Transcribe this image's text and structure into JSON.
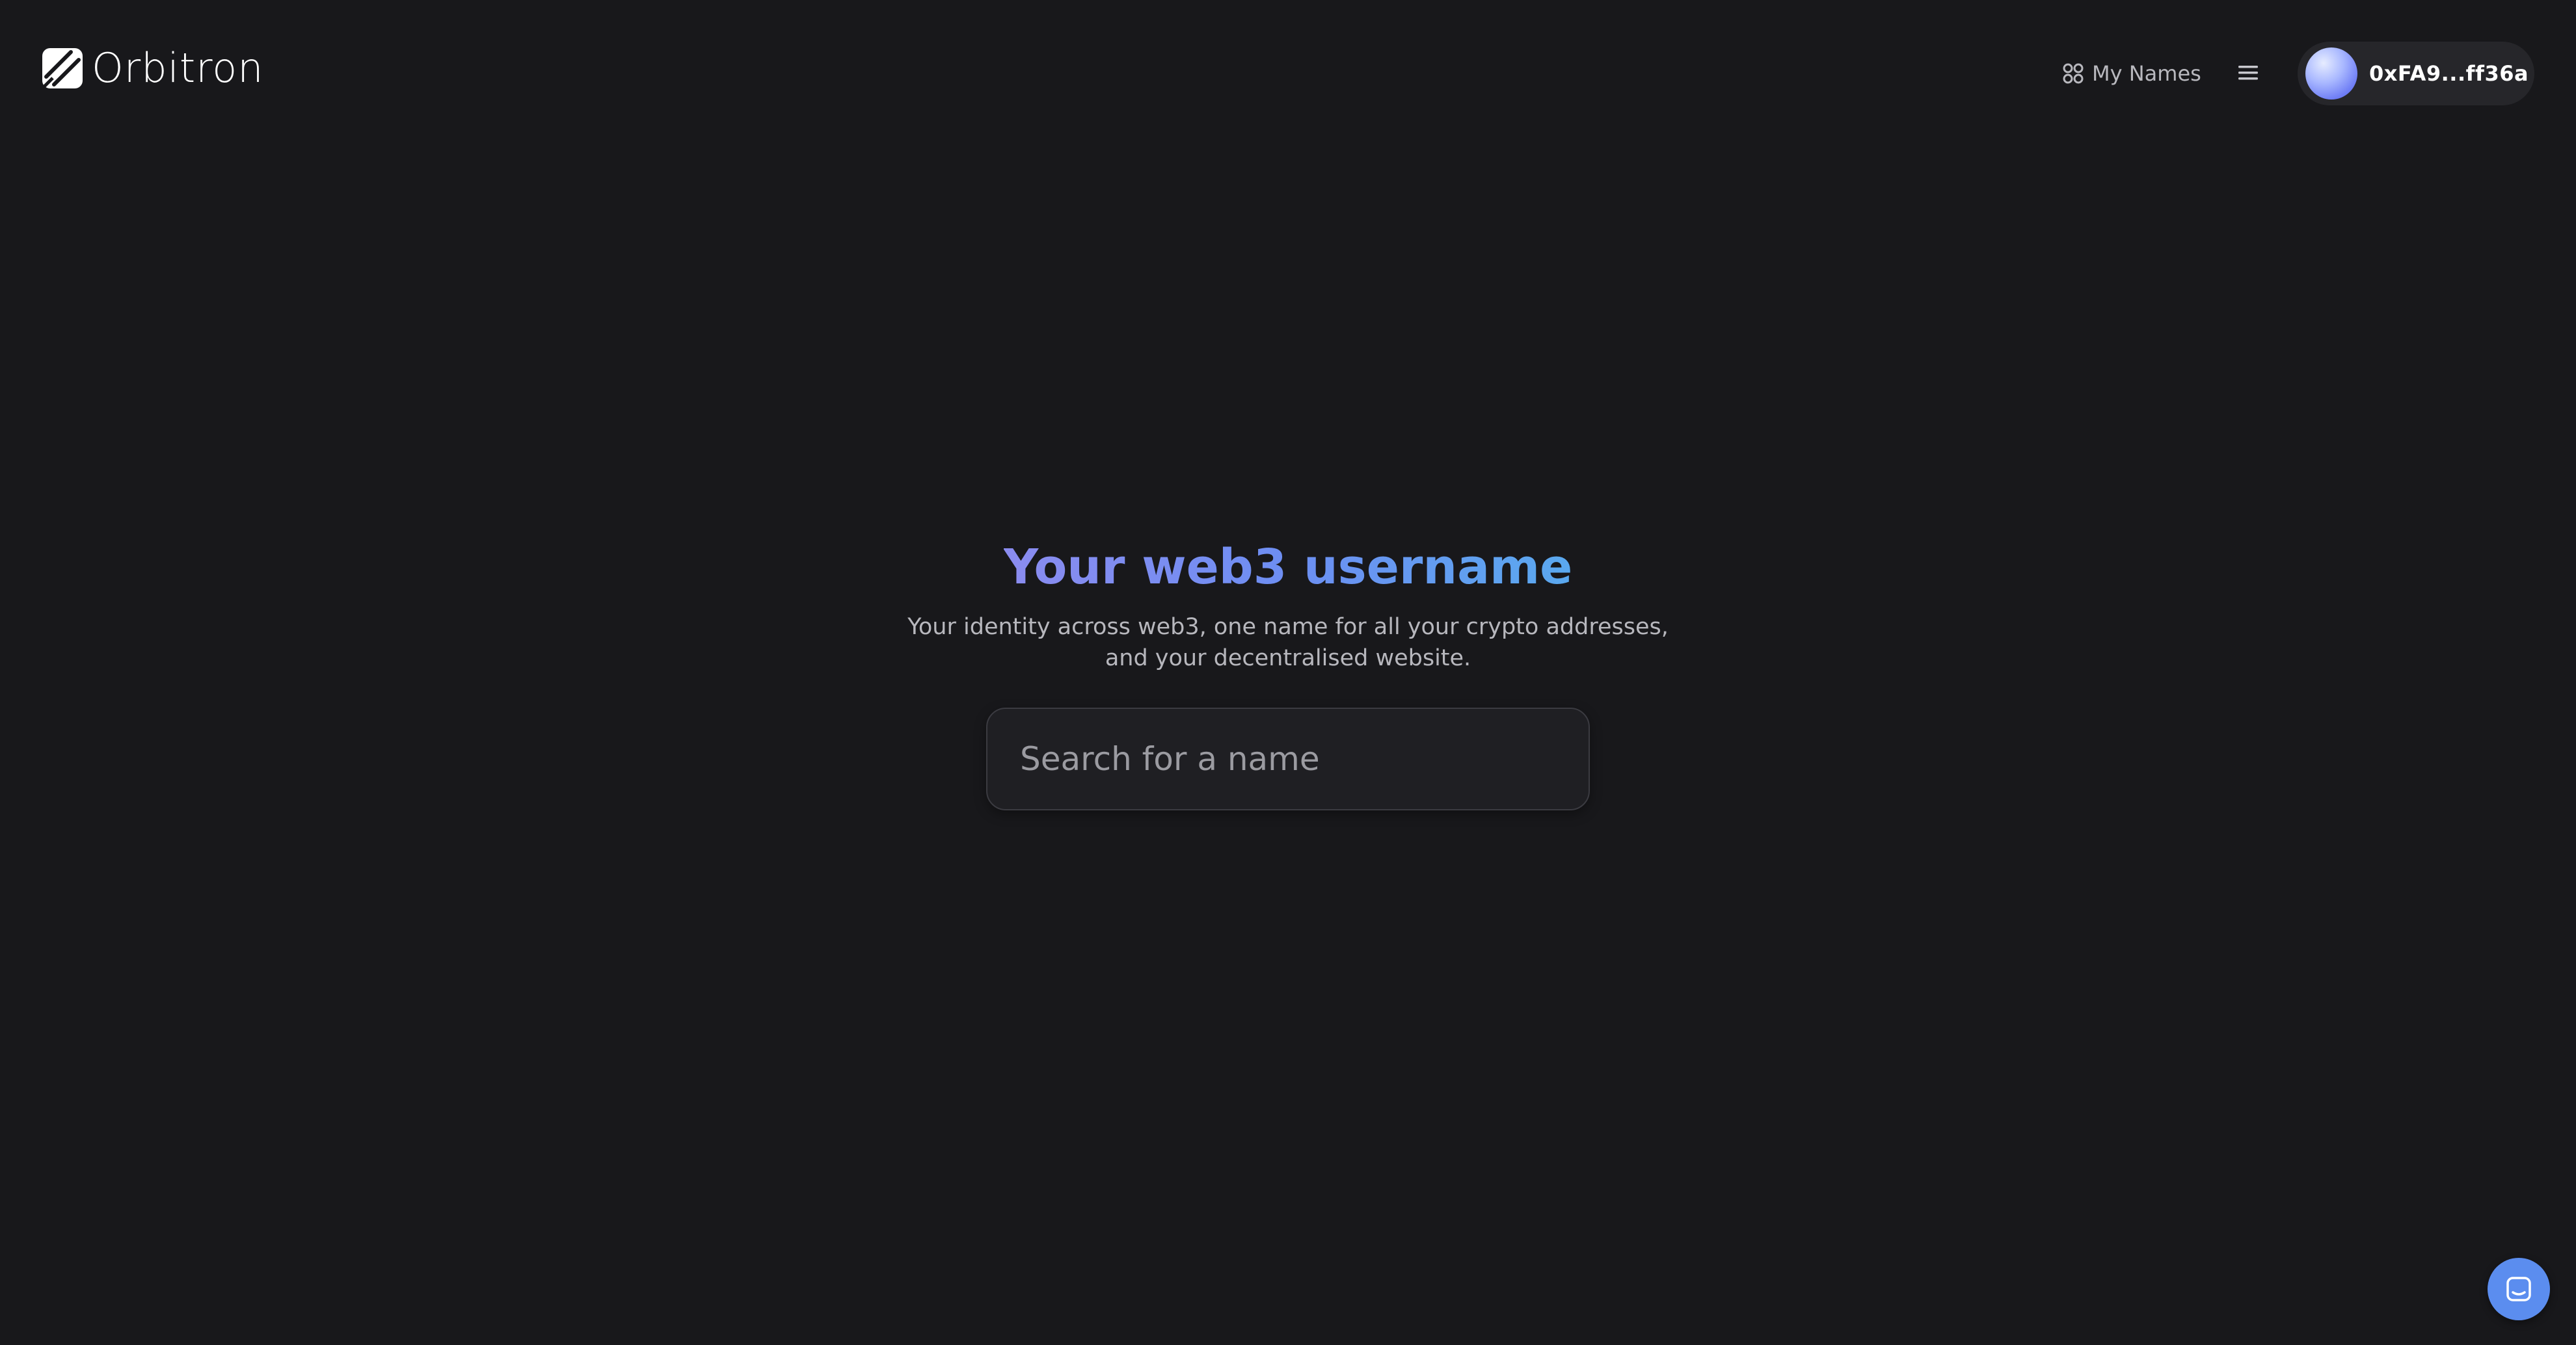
{
  "header": {
    "logo_text": "Orbitron",
    "my_names_label": "My Names",
    "wallet_address": "0xFA9...ff36a"
  },
  "hero": {
    "title": "Your web3 username",
    "subtitle_line1": "Your identity across web3, one name for all your crypto addresses,",
    "subtitle_line2": "and your decentralised website."
  },
  "search": {
    "placeholder": "Search for a name",
    "value": ""
  },
  "icons": {
    "logo": "orbitron-logo-icon",
    "my_names": "grid-icon",
    "menu": "hamburger-menu-icon",
    "chat": "chat-bubble-icon"
  },
  "colors": {
    "background": "#18181b",
    "accent_blue": "#5b8def",
    "title_gradient_start": "#8b8cf0",
    "title_gradient_end": "#5aa9ef"
  }
}
